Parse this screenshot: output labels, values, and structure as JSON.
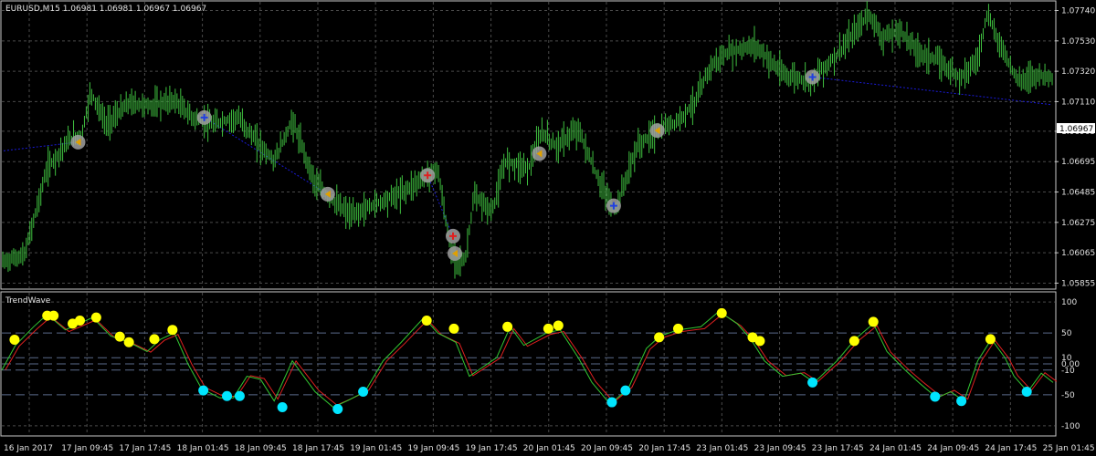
{
  "colors": {
    "background": "#000000",
    "grid": "#4a4a4a",
    "axis": "#c8c8c8",
    "candle": "#3fbf3f",
    "trendline": "#1a1ad8",
    "wave_main": "#32c832",
    "wave_signal": "#e02020",
    "dot_high": "#ffff00",
    "dot_low": "#00e5ff",
    "marker": "#a0a0a0",
    "price_box_bg": "#ffffff"
  },
  "main_panel": {
    "header": "EURUSD,M15  1.06981 1.06981 1.06967 1.06967",
    "current_price": "1.06967"
  },
  "indicator_panel": {
    "header": "TrendWave"
  },
  "chart_data": [
    {
      "type": "line",
      "role": "price",
      "title": "EURUSD,M15",
      "ylim": [
        1.0582,
        1.078
      ],
      "y_ticks": [
        "1.07740",
        "1.07530",
        "1.07320",
        "1.07110",
        "1.06905",
        "1.06695",
        "1.06485",
        "1.06275",
        "1.06065",
        "1.05855"
      ],
      "x_ticks": [
        "16 Jan 2017",
        "17 Jan 09:45",
        "17 Jan 17:45",
        "18 Jan 01:45",
        "18 Jan 09:45",
        "18 Jan 17:45",
        "19 Jan 01:45",
        "19 Jan 09:45",
        "19 Jan 17:45",
        "20 Jan 01:45",
        "20 Jan 09:45",
        "20 Jan 17:45",
        "23 Jan 01:45",
        "23 Jan 09:45",
        "23 Jan 17:45",
        "24 Jan 01:45",
        "24 Jan 09:45",
        "24 Jan 17:45",
        "25 Jan 01:45"
      ],
      "x_range": [
        0,
        1160
      ],
      "series": [
        {
          "values": [
            [
              0,
              1.06
            ],
            [
              25,
              1.0605
            ],
            [
              50,
              1.0665
            ],
            [
              75,
              1.0685
            ],
            [
              88,
              1.0688
            ],
            [
              98,
              1.0718
            ],
            [
              115,
              1.0695
            ],
            [
              140,
              1.071
            ],
            [
              165,
              1.0708
            ],
            [
              190,
              1.0712
            ],
            [
              210,
              1.07
            ],
            [
              230,
              1.0695
            ],
            [
              260,
              1.07
            ],
            [
              285,
              1.068
            ],
            [
              300,
              1.067
            ],
            [
              320,
              1.0698
            ],
            [
              345,
              1.0655
            ],
            [
              360,
              1.0645
            ],
            [
              385,
              1.0632
            ],
            [
              410,
              1.064
            ],
            [
              440,
              1.0648
            ],
            [
              468,
              1.066
            ],
            [
              480,
              1.0665
            ],
            [
              495,
              1.0605
            ],
            [
              510,
              1.06
            ],
            [
              520,
              1.0645
            ],
            [
              540,
              1.0635
            ],
            [
              555,
              1.067
            ],
            [
              580,
              1.0665
            ],
            [
              595,
              1.069
            ],
            [
              610,
              1.068
            ],
            [
              635,
              1.0692
            ],
            [
              655,
              1.066
            ],
            [
              675,
              1.0635
            ],
            [
              700,
              1.068
            ],
            [
              720,
              1.069
            ],
            [
              745,
              1.0698
            ],
            [
              765,
              1.0712
            ],
            [
              780,
              1.0735
            ],
            [
              800,
              1.0745
            ],
            [
              830,
              1.075
            ],
            [
              860,
              1.073
            ],
            [
              890,
              1.0725
            ],
            [
              915,
              1.074
            ],
            [
              935,
              1.0755
            ],
            [
              955,
              1.0772
            ],
            [
              970,
              1.0755
            ],
            [
              990,
              1.076
            ],
            [
              1010,
              1.0745
            ],
            [
              1030,
              1.074
            ],
            [
              1055,
              1.0728
            ],
            [
              1075,
              1.074
            ],
            [
              1085,
              1.0772
            ],
            [
              1100,
              1.075
            ],
            [
              1120,
              1.0725
            ],
            [
              1140,
              1.073
            ],
            [
              1155,
              1.0728
            ]
          ]
        }
      ]
    },
    {
      "type": "line",
      "role": "oscillator",
      "title": "TrendWave",
      "ylim": [
        -115,
        115
      ],
      "y_ticks": [
        "100",
        "50",
        "10",
        "0.00",
        "-10",
        "-50",
        "-100"
      ],
      "x_range": [
        0,
        1160
      ],
      "series": [
        {
          "name": "wave",
          "values": [
            [
              0,
              -10
            ],
            [
              15,
              30
            ],
            [
              35,
              60
            ],
            [
              50,
              80
            ],
            [
              70,
              55
            ],
            [
              85,
              65
            ],
            [
              100,
              75
            ],
            [
              120,
              45
            ],
            [
              140,
              35
            ],
            [
              160,
              20
            ],
            [
              175,
              40
            ],
            [
              190,
              50
            ],
            [
              205,
              0
            ],
            [
              220,
              -40
            ],
            [
              240,
              -55
            ],
            [
              255,
              -55
            ],
            [
              270,
              -20
            ],
            [
              285,
              -25
            ],
            [
              300,
              -60
            ],
            [
              320,
              5
            ],
            [
              345,
              -45
            ],
            [
              365,
              -70
            ],
            [
              380,
              -60
            ],
            [
              400,
              -45
            ],
            [
              420,
              5
            ],
            [
              440,
              35
            ],
            [
              465,
              75
            ],
            [
              480,
              50
            ],
            [
              500,
              35
            ],
            [
              515,
              -20
            ],
            [
              530,
              -5
            ],
            [
              545,
              10
            ],
            [
              560,
              60
            ],
            [
              575,
              30
            ],
            [
              600,
              50
            ],
            [
              615,
              55
            ],
            [
              635,
              10
            ],
            [
              650,
              -30
            ],
            [
              670,
              -65
            ],
            [
              690,
              -40
            ],
            [
              710,
              25
            ],
            [
              725,
              45
            ],
            [
              745,
              55
            ],
            [
              770,
              60
            ],
            [
              790,
              85
            ],
            [
              810,
              65
            ],
            [
              825,
              40
            ],
            [
              840,
              5
            ],
            [
              860,
              -20
            ],
            [
              880,
              -15
            ],
            [
              895,
              -30
            ],
            [
              920,
              5
            ],
            [
              940,
              40
            ],
            [
              960,
              65
            ],
            [
              975,
              20
            ],
            [
              995,
              -10
            ],
            [
              1010,
              -30
            ],
            [
              1030,
              -55
            ],
            [
              1045,
              -45
            ],
            [
              1060,
              -60
            ],
            [
              1075,
              5
            ],
            [
              1090,
              40
            ],
            [
              1105,
              10
            ],
            [
              1115,
              -20
            ],
            [
              1130,
              -45
            ],
            [
              1145,
              -15
            ],
            [
              1158,
              -30
            ]
          ]
        }
      ],
      "dots_high": [
        [
          14,
          39
        ],
        [
          50,
          78
        ],
        [
          57,
          78
        ],
        [
          78,
          65
        ],
        [
          86,
          70
        ],
        [
          104,
          75
        ],
        [
          130,
          44
        ],
        [
          140,
          35
        ],
        [
          168,
          40
        ],
        [
          188,
          55
        ],
        [
          468,
          70
        ],
        [
          498,
          57
        ],
        [
          557,
          60
        ],
        [
          602,
          57
        ],
        [
          613,
          62
        ],
        [
          724,
          43
        ],
        [
          745,
          57
        ],
        [
          793,
          82
        ],
        [
          827,
          43
        ],
        [
          835,
          37
        ],
        [
          939,
          37
        ],
        [
          960,
          68
        ],
        [
          1089,
          40
        ]
      ],
      "dots_low": [
        [
          222,
          -43
        ],
        [
          248,
          -52
        ],
        [
          262,
          -52
        ],
        [
          309,
          -70
        ],
        [
          370,
          -73
        ],
        [
          398,
          -45
        ],
        [
          672,
          -62
        ],
        [
          687,
          -43
        ],
        [
          893,
          -30
        ],
        [
          1028,
          -53
        ],
        [
          1057,
          -60
        ],
        [
          1129,
          -45
        ]
      ]
    }
  ],
  "markers": [
    {
      "x": 84,
      "y": 1.0683,
      "kind": "arrow-left"
    },
    {
      "x": 223,
      "y": 1.07,
      "kind": "plus"
    },
    {
      "x": 359,
      "y": 1.0647,
      "kind": "arrow-left"
    },
    {
      "x": 469,
      "y": 1.066,
      "kind": "plus-red"
    },
    {
      "x": 497,
      "y": 1.0618,
      "kind": "plus-red"
    },
    {
      "x": 499,
      "y": 1.0606,
      "kind": "arrow-left"
    },
    {
      "x": 592,
      "y": 1.0675,
      "kind": "arrow-left"
    },
    {
      "x": 674,
      "y": 1.0639,
      "kind": "plus"
    },
    {
      "x": 722,
      "y": 1.0691,
      "kind": "arrow-left"
    },
    {
      "x": 893,
      "y": 1.0728,
      "kind": "plus"
    }
  ]
}
